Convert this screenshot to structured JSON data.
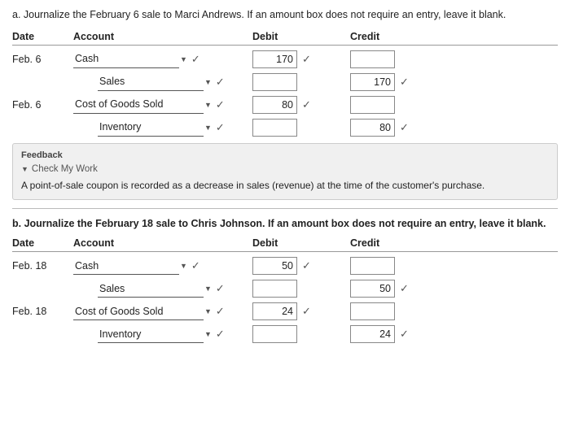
{
  "page": {
    "instruction_a": "a. Journalize the February 6 sale to Marci Andrews. If an amount box does not require an entry, leave it blank.",
    "instruction_b": "b. Journalize the February 18 sale to Chris Johnson. If an amount box does not require an entry, leave it blank.",
    "headers": {
      "date": "Date",
      "account": "Account",
      "debit": "Debit",
      "credit": "Credit"
    },
    "section_a": {
      "rows": [
        {
          "date": "Feb. 6",
          "account": "Cash",
          "indented": false,
          "debit_value": "170",
          "credit_value": "",
          "debit_check": true,
          "credit_check": false,
          "account_check": true
        },
        {
          "date": "",
          "account": "Sales",
          "indented": true,
          "debit_value": "",
          "credit_value": "170",
          "debit_check": false,
          "credit_check": true,
          "account_check": true
        },
        {
          "date": "Feb. 6",
          "account": "Cost of Goods Sold",
          "indented": false,
          "debit_value": "80",
          "credit_value": "",
          "debit_check": true,
          "credit_check": false,
          "account_check": true
        },
        {
          "date": "",
          "account": "Inventory",
          "indented": true,
          "debit_value": "",
          "credit_value": "80",
          "debit_check": false,
          "credit_check": true,
          "account_check": true
        }
      ]
    },
    "feedback": {
      "label": "Feedback",
      "check_my_work": "Check My Work",
      "text": "A point-of-sale coupon is recorded as a decrease in sales (revenue) at the time of the customer's purchase."
    },
    "section_b": {
      "rows": [
        {
          "date": "Feb. 18",
          "account": "Cash",
          "indented": false,
          "debit_value": "50",
          "credit_value": "",
          "debit_check": true,
          "credit_check": false,
          "account_check": true
        },
        {
          "date": "",
          "account": "Sales",
          "indented": true,
          "debit_value": "",
          "credit_value": "50",
          "debit_check": false,
          "credit_check": true,
          "account_check": true
        },
        {
          "date": "Feb. 18",
          "account": "Cost of Goods Sold",
          "indented": false,
          "debit_value": "24",
          "credit_value": "",
          "debit_check": true,
          "credit_check": false,
          "account_check": true
        },
        {
          "date": "",
          "account": "Inventory",
          "indented": true,
          "debit_value": "",
          "credit_value": "24",
          "debit_check": false,
          "credit_check": true,
          "account_check": true
        }
      ]
    }
  }
}
